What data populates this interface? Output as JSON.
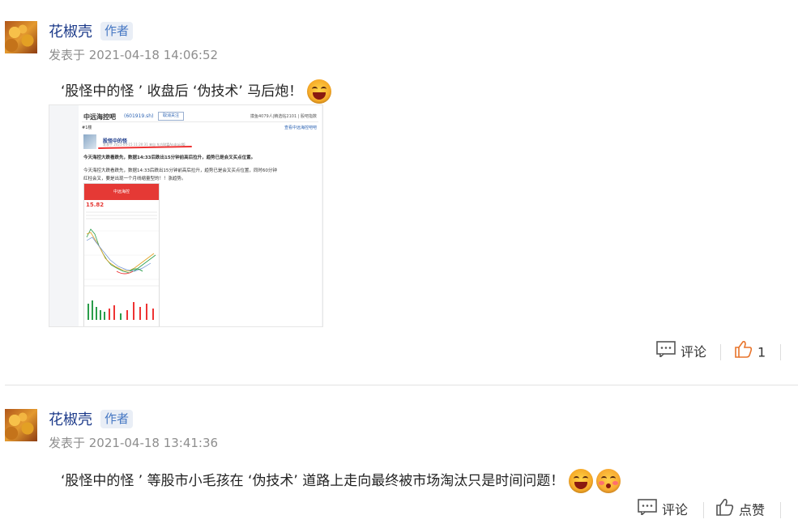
{
  "posts": [
    {
      "author": "花椒壳",
      "badge": "作者",
      "time": "发表于 2021-04-18 14:06:52",
      "content": "‘股怪中的怪 ’ 收盘后 ‘伪技术’ 马后炮！",
      "emojis": [
        "laughing-face-icon"
      ],
      "image": {
        "title": "中远海控吧",
        "url": "(601919.sh)",
        "button": "取消关注",
        "right_text": "摸鱼4079人|精选帖2101 | 股吧指数",
        "floor": "#1楼",
        "right_link": "查看中远海控吧吧",
        "post_author": "股怪中的怪",
        "post_meta": "发表于 2021-04-15 11:20:31 来自 东方财富Android版",
        "line1": "今天海控大跌看跌先，数据14:33后跌出15分钟前高后拉升，趋势已是会叉买点位置。",
        "line2": "今天海控大跌看跌先，数据14:33后跌出15分钟前高后拉升，趋势已是会叉买点位置，同时60分钟",
        "line3": "红柱会叉，要是出现一个月线缩量型的！！涨趋势。",
        "phone_title": "中远海控",
        "phone_price": "15.82"
      },
      "actions": {
        "comment": "评论",
        "like_count": "1"
      }
    },
    {
      "author": "花椒壳",
      "badge": "作者",
      "time": "发表于 2021-04-18 13:41:36",
      "content": "‘股怪中的怪 ’ 等股市小毛孩在 ‘伪技术’ 道路上走向最终被市场淘汰只是时间问题！",
      "emojis": [
        "laughing-face-icon",
        "blushing-face-icon"
      ],
      "actions": {
        "comment": "评论",
        "like": "点赞"
      }
    }
  ],
  "colors": {
    "name": "#1d3b8a",
    "badge_bg": "#e9eef6",
    "badge_text": "#4577c3",
    "like_active": "#e8742b"
  }
}
